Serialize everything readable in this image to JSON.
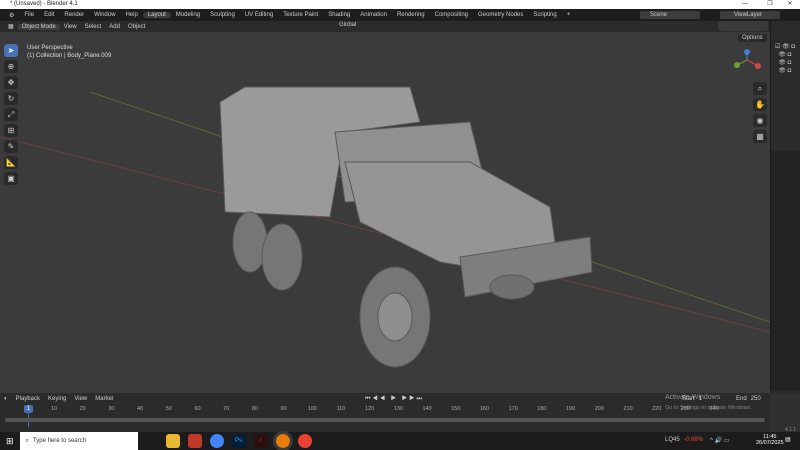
{
  "window": {
    "title": "* (Unsaved) - Blender 4.1",
    "minimize": "—",
    "maximize": "❐",
    "close": "✕"
  },
  "menu": [
    "File",
    "Edit",
    "Render",
    "Window",
    "Help"
  ],
  "workspaces": [
    "Layout",
    "Modeling",
    "Sculpting",
    "UV Editing",
    "Texture Paint",
    "Shading",
    "Animation",
    "Rendering",
    "Compositing",
    "Geometry Nodes",
    "Scripting",
    "+"
  ],
  "scene": "Scene",
  "view_layer": "ViewLayer",
  "header": {
    "mode": "Object Mode",
    "items": [
      "View",
      "Select",
      "Add",
      "Object"
    ],
    "orientation": "Global",
    "options": "Options"
  },
  "viewport": {
    "perspective": "User Perspective",
    "collection": "(1) Collection | Body_Plane.009"
  },
  "timeline": {
    "menu": [
      "Playback",
      "Keying",
      "View",
      "Marker"
    ],
    "current_frame": "1",
    "start_label": "Start",
    "start": "1",
    "end_label": "End",
    "end": "250",
    "ticks": [
      "10",
      "20",
      "30",
      "40",
      "50",
      "60",
      "70",
      "80",
      "90",
      "100",
      "110",
      "120",
      "130",
      "140",
      "150",
      "160",
      "170",
      "180",
      "190",
      "200",
      "210",
      "220",
      "230",
      "240"
    ]
  },
  "watermark": {
    "line1": "Activate Windows",
    "line2": "Go to Settings to activate Windows."
  },
  "version": "4.1.1",
  "taskbar": {
    "search_placeholder": "Type here to search",
    "stock": "LQ45",
    "stock_change": "-0.66%",
    "time": "11:45",
    "date": "26/07/2025"
  }
}
